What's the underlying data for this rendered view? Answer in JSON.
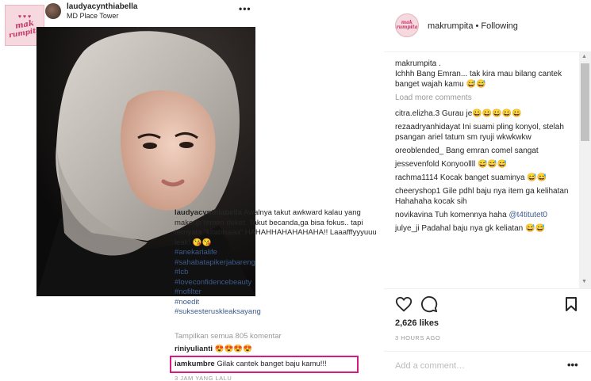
{
  "logo": {
    "line1": "mak",
    "line2": "rumpita",
    "hearts": "♥ ♥ ♥"
  },
  "post": {
    "username": "laudyacynthiabella",
    "location": "MD Place Tower",
    "more": "•••",
    "caption_user": "laudyacynthiabella",
    "caption_text": " Awalnya takut awkward kalau yang makeup temen deket. Takut becanda,ga bisa fokus.. tapi ternyata “kitabisaaa” HAHAHHAHAHAHAHA!! Laaafffyyyuuu leak! 😘😘",
    "hashtags": [
      "#anekarialife",
      "#sahabatapikerjabareng",
      "#lcb",
      "#loveconfidencebeauty",
      "#nofilter",
      "#noedit",
      "#suksesteruskleaksayang"
    ],
    "view_all": "Tampilkan semua 805 komentar",
    "comment1_user": "riniyulianti",
    "comment1_text": " 😍😍😍😍",
    "comment2_user": "iamkumbre",
    "comment2_text": " Gilak cantek banget baju kamu!!!",
    "timestamp": "3 JAM YANG LALU"
  },
  "right": {
    "account": "makrumpita",
    "follow_status": " • Following",
    "avatar_text": [
      "mak",
      "rumpita"
    ],
    "comments": [
      {
        "user": "makrumpita",
        "text": " .\nIchhh Bang Emran... tak kira mau bilang cantek banget wajah kamu 😅😅"
      },
      {
        "load_more": "Load more comments"
      },
      {
        "user": "citra.elizha.3",
        "text": " Gurau je😀😀😀😀😀"
      },
      {
        "user": "rezaadryanhidayat",
        "text": " Ini suami pling konyol, stelah psangan ariel tatum sm ryuji wkwkwkw"
      },
      {
        "user": "oreoblended_",
        "text": " Bang emran comel sangat"
      },
      {
        "user": "jessevenfold",
        "text": " Konyoollll 😅😅😅"
      },
      {
        "user": "rachma1114",
        "text": " Kocak banget suaminya 😅😅"
      },
      {
        "user": "cheeryshop1",
        "text": " Gile pdhl baju nya item ga kelihatan Hahahaha kocak sih"
      },
      {
        "user": "novikavina",
        "text": " Tuh komennya haha ",
        "mention": "@t4titutet0"
      },
      {
        "user": "julye_ji",
        "text": " Padahal baju nya gk keliatan 😅😅"
      }
    ],
    "likes": "2,626 likes",
    "time": "3 HOURS AGO",
    "add_comment_placeholder": "Add a comment…",
    "more": "•••"
  },
  "colors": {
    "highlight_border": "#d81b7f",
    "hashtag": "#3d5a8a",
    "logo_pink": "#c4366a"
  }
}
